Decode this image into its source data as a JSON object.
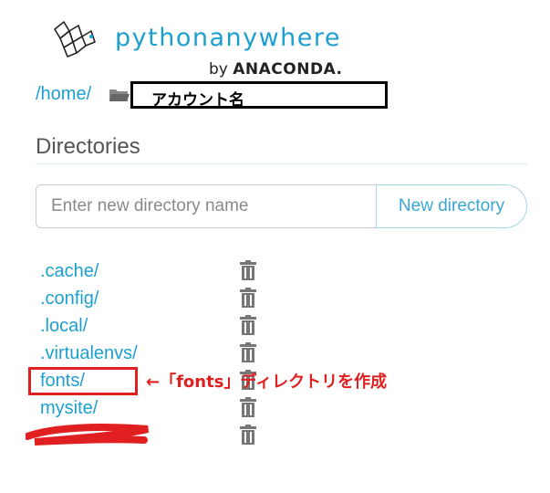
{
  "brand": {
    "wordmark_part1": "python",
    "wordmark_part2": "anywhere",
    "by_text": "by",
    "company": "ANACONDA.",
    "accent_color": "#1d9fd0"
  },
  "breadcrumb": {
    "home": "/home/",
    "folder_icon": "folder-icon",
    "account": "アカウント名"
  },
  "directories": {
    "title": "Directories",
    "input_placeholder": "Enter new directory name",
    "input_value": "",
    "new_button_label": "New directory",
    "items": [
      {
        "label": ".cache/",
        "icon": "trash-icon"
      },
      {
        "label": ".config/",
        "icon": "trash-icon"
      },
      {
        "label": ".local/",
        "icon": "trash-icon"
      },
      {
        "label": ".virtualenvs/",
        "icon": "trash-icon"
      },
      {
        "label": "fonts/",
        "icon": "trash-icon"
      },
      {
        "label": "mysite/",
        "icon": "trash-icon"
      },
      {
        "label": "",
        "icon": "trash-icon"
      }
    ]
  },
  "annotation": {
    "text": "←「fonts」ディレクトリを作成",
    "color": "#e02020"
  }
}
